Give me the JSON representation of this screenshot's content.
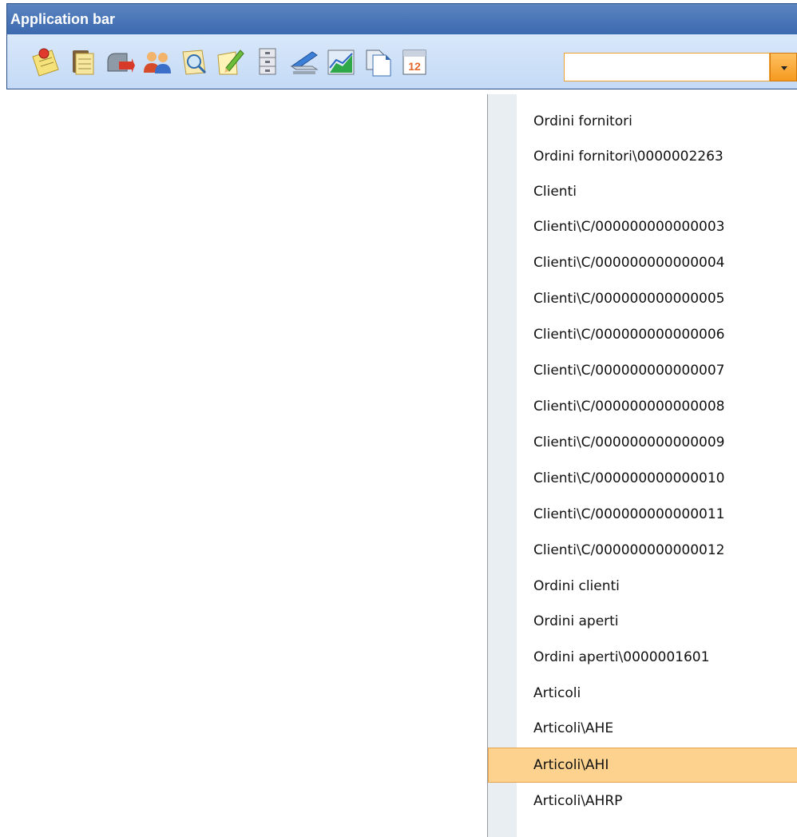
{
  "appbar": {
    "title": "Application bar",
    "toolbar_icons": [
      "note-pin-icon",
      "clipboard-icon",
      "mailbox-icon",
      "users-icon",
      "search-document-icon",
      "edit-pencil-icon",
      "file-cabinet-icon",
      "scanner-icon",
      "chart-icon",
      "documents-icon",
      "calendar-icon"
    ],
    "calendar_day": "12",
    "search_value": "",
    "accent_color": "#f59a20",
    "bar_color": "#3c6ab0"
  },
  "dropdown": {
    "items": [
      "Ordini fornitori",
      "Ordini fornitori\\0000002263",
      "Clienti",
      "Clienti\\C/000000000000003",
      "Clienti\\C/000000000000004",
      "Clienti\\C/000000000000005",
      "Clienti\\C/000000000000006",
      "Clienti\\C/000000000000007",
      "Clienti\\C/000000000000008",
      "Clienti\\C/000000000000009",
      "Clienti\\C/000000000000010",
      "Clienti\\C/000000000000011",
      "Clienti\\C/000000000000012",
      "Ordini clienti",
      "Ordini aperti",
      "Ordini aperti\\0000001601",
      "Articoli",
      "Articoli\\AHE",
      "Articoli\\AHI",
      "Articoli\\AHRP"
    ],
    "selected_index": 18
  }
}
